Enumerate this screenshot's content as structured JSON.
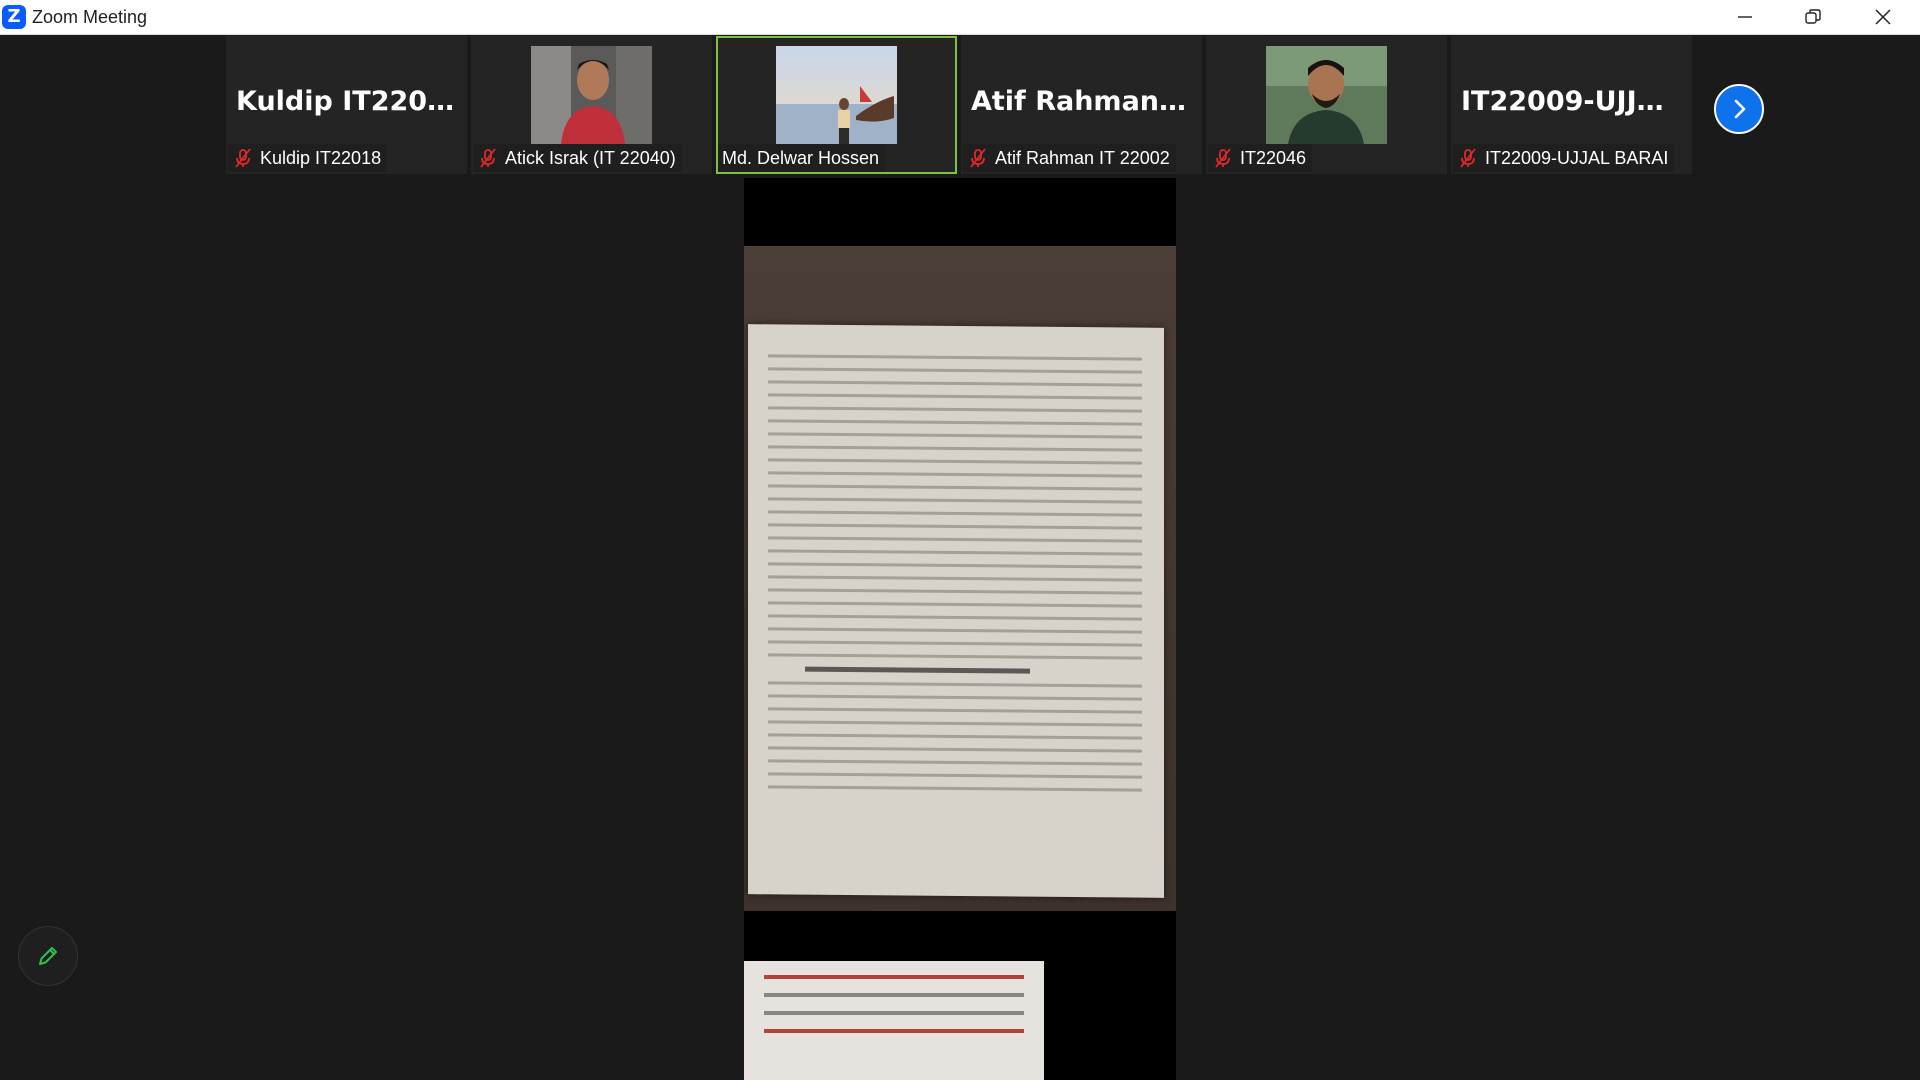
{
  "window": {
    "title": "Zoom Meeting",
    "logo_letter": "Z",
    "controls": [
      "minimize-icon",
      "restore-icon",
      "close-icon"
    ]
  },
  "gallery": {
    "tiles": [
      {
        "display_name": "Kuldip IT22018",
        "label": "Kuldip IT22018",
        "muted": true,
        "video": false
      },
      {
        "display_name": "",
        "label": "Atick Israk (IT 22040)",
        "muted": true,
        "video": true
      },
      {
        "display_name": "",
        "label": "Md. Delwar Hossen",
        "muted": false,
        "video": true,
        "active_speaker": true
      },
      {
        "display_name": "Atif Rahman IT...",
        "label": "Atif Rahman IT 22002",
        "muted": true,
        "video": false
      },
      {
        "display_name": "",
        "label": "IT22046",
        "muted": true,
        "video": true
      },
      {
        "display_name": "IT22009-UJJAL...",
        "label": "IT22009-UJJAL BARAI",
        "muted": true,
        "video": false
      }
    ],
    "next_page_icon": "chevron-right-icon"
  },
  "main_share": {
    "content": "camera-view-of-book-page"
  },
  "annotate": {
    "icon": "pencil-icon"
  },
  "colors": {
    "active_speaker_border": "#7cc243",
    "mute_red": "#e02828",
    "accent_blue": "#0e72ed",
    "background": "#1a1a1a"
  }
}
